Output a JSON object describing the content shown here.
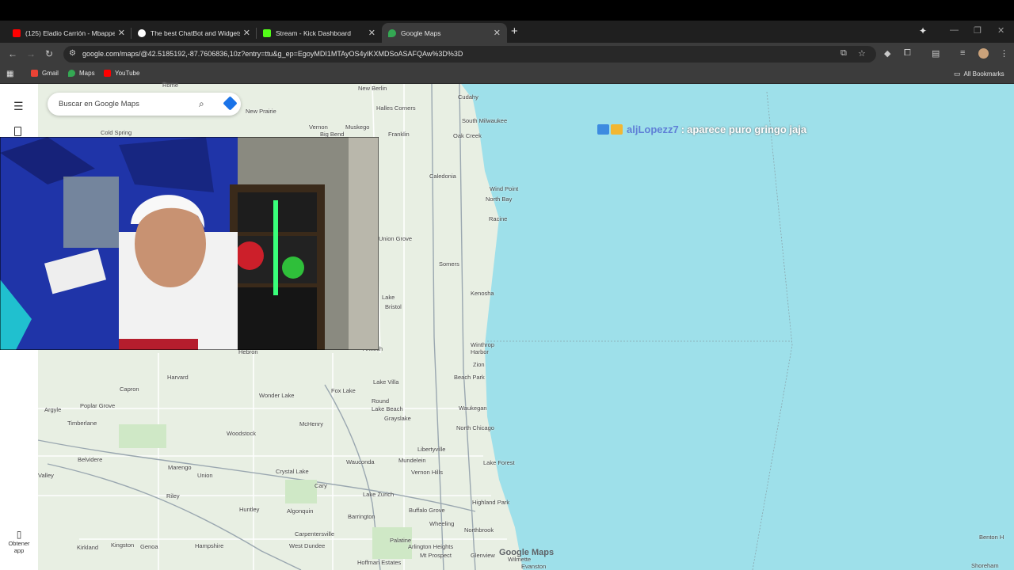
{
  "browser": {
    "tabs": [
      {
        "label": "(125) Eladio Carrión - Mbappe",
        "favicon_color": "#ff0000",
        "active": false
      },
      {
        "label": "The best ChatBot and Widgets",
        "favicon_color": "#ffffff",
        "active": false
      },
      {
        "label": "Stream - Kick Dashboard",
        "favicon_color": "#53fc18",
        "active": false
      },
      {
        "label": "Google Maps",
        "favicon_color": "#34a853",
        "active": true
      }
    ],
    "url": "google.com/maps/@42.5185192,-87.7606836,10z?entry=ttu&g_ep=EgoyMDI1MTAyOS4yIKXMDSoASAFQAw%3D%3D",
    "bookmarks": [
      {
        "label": "Gmail",
        "icon": "gmail-icon",
        "color": "#ea4335"
      },
      {
        "label": "Maps",
        "icon": "maps-icon",
        "color": "#34a853"
      },
      {
        "label": "YouTube",
        "icon": "youtube-icon",
        "color": "#ff0000"
      }
    ],
    "all_bookmarks": "All Bookmarks"
  },
  "maps": {
    "search_placeholder": "Buscar en Google Maps",
    "get_app_line1": "Obtener",
    "get_app_line2": "app",
    "logo": "Google Maps",
    "water_color": "#9ee0ea",
    "land_color": "#e8efe3",
    "places": [
      "Rome",
      "New Berlin",
      "Cudahy",
      "Halles Corners",
      "New Prairie",
      "Vernon",
      "Muskego",
      "South Milwaukee",
      "Oak Creek",
      "Franklin",
      "Cold Spring",
      "Big Bend",
      "Caledonia",
      "Wind Point",
      "North Bay",
      "Racine",
      "Union Grove",
      "Somers",
      "Kenosha",
      "Lake",
      "Bristol",
      "Winthrop Harbor",
      "Zion",
      "Beach Park",
      "Hebron",
      "Antioch",
      "Harvard",
      "Capron",
      "Wonder Lake",
      "Fox Lake",
      "Lake Villa",
      "Round Lake Beach",
      "Grayslake",
      "Waukegan",
      "North Chicago",
      "Poplar Grove",
      "Argyle",
      "Timberlane",
      "Woodstock",
      "McHenry",
      "Libertyville",
      "Lake Forest",
      "Belvidere",
      "Marengo",
      "Crystal Lake",
      "Wauconda",
      "Mundelein",
      "Vernon Hills",
      "Cary",
      "Lake Zurich",
      "Highland Park",
      "Union",
      "Riley",
      "Huntley",
      "Algonquin",
      "Barrington",
      "Buffalo Grove",
      "Wheeling",
      "Northbrook",
      "Kirkland",
      "Kingston",
      "Genoa",
      "Hampshire",
      "Carpentersville",
      "West Dundee",
      "Palatine",
      "Arlington Heights",
      "Mt Prospect",
      "Glenview",
      "Wilmette",
      "Evanston",
      "Hoffman Estates",
      "Benton H",
      "Shoreham",
      "Valley"
    ]
  },
  "chat": {
    "username": "aljLopezz7",
    "separator": ":",
    "message": "aparece puro gringo jaja"
  }
}
